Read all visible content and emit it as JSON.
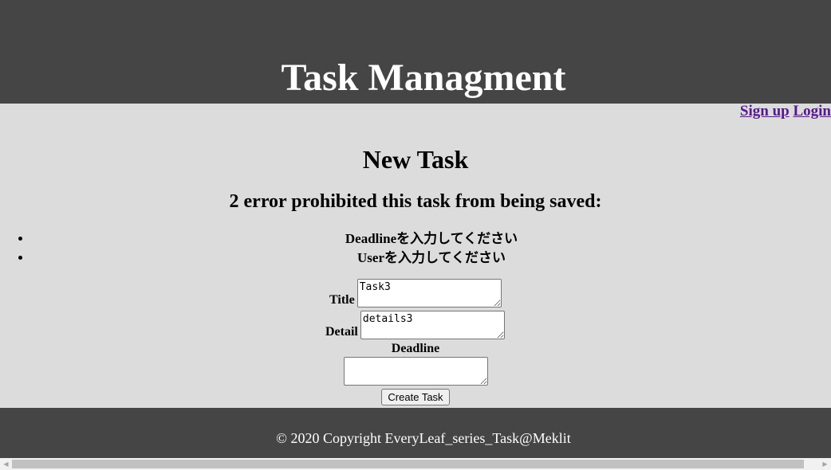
{
  "header": {
    "title": "Task Managment"
  },
  "auth_nav": {
    "signup_label": "Sign up",
    "login_label": "Login"
  },
  "main": {
    "page_title": "New Task",
    "error_heading": "2 error prohibited this task from being saved:",
    "errors": [
      "Deadlineを入力してください",
      "Userを入力してください"
    ]
  },
  "form": {
    "title_label": "Title",
    "title_value": "Task3",
    "detail_label": "Detail",
    "detail_value": "details3",
    "deadline_label": "Deadline",
    "deadline_value": "",
    "submit_label": "Create Task"
  },
  "footer": {
    "copyright": "© 2020 Copyright EveryLeaf_series_Task@Meklit"
  },
  "scrollbar": {
    "left_icon": "scroll-left-arrow",
    "right_icon": "scroll-right-arrow",
    "left_glyph": "◀",
    "right_glyph": "▶"
  }
}
